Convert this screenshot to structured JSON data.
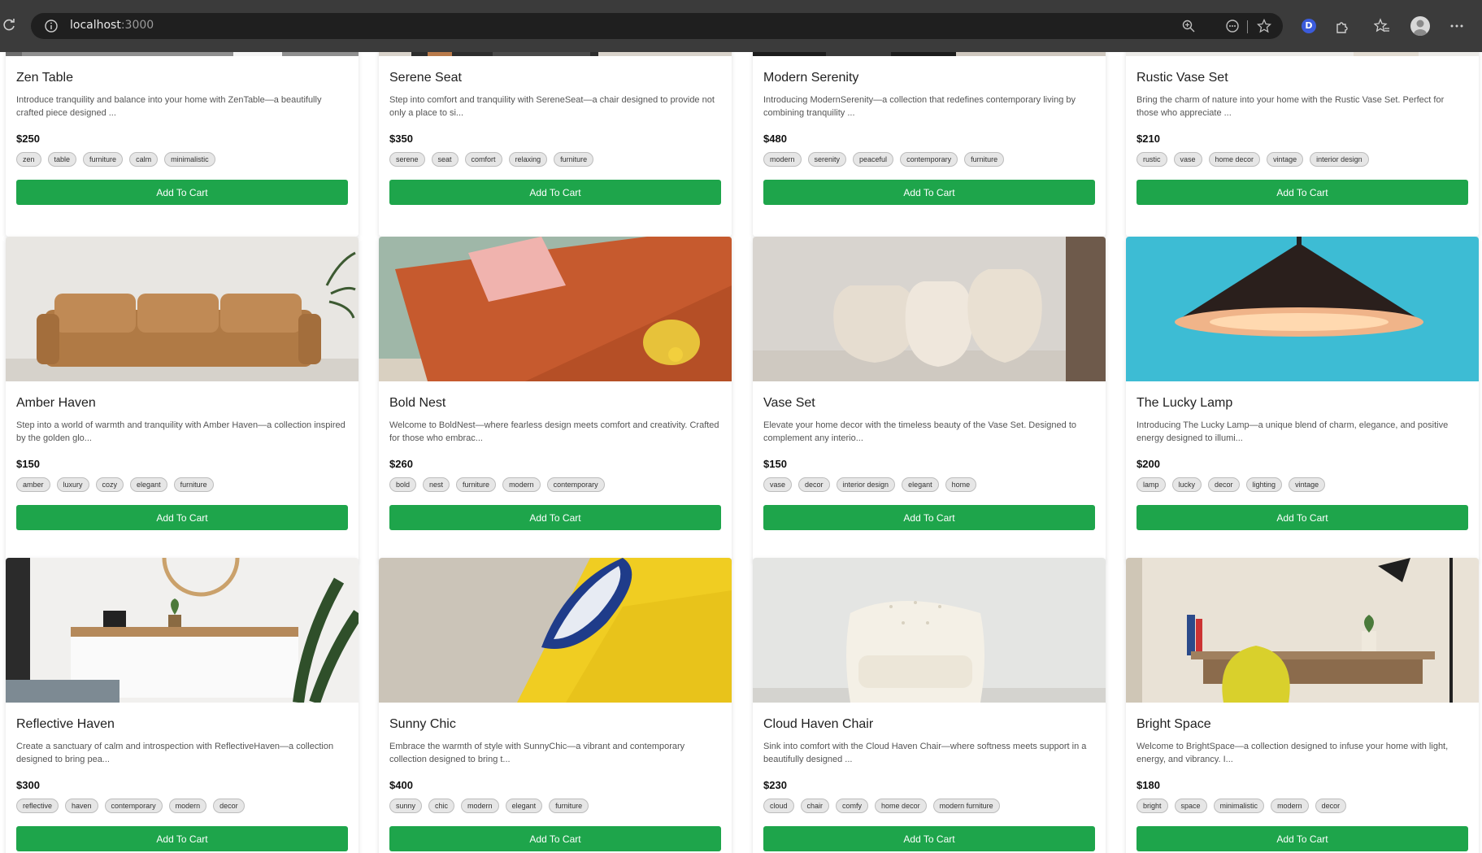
{
  "browser": {
    "url_host": "localhost",
    "url_port": ":3000"
  },
  "products": [
    {
      "title": "Zen Table",
      "description": "Introduce tranquility and balance into your home with ZenTable—a beautifully crafted piece designed ...",
      "price": "$250",
      "tags": [
        "zen",
        "table",
        "furniture",
        "calm",
        "minimalistic"
      ],
      "button": "Add To Cart",
      "image": "zen-table-photo"
    },
    {
      "title": "Serene Seat",
      "description": "Step into comfort and tranquility with SereneSeat—a chair designed to provide not only a place to si...",
      "price": "$350",
      "tags": [
        "serene",
        "seat",
        "comfort",
        "relaxing",
        "furniture"
      ],
      "button": "Add To Cart",
      "image": "serene-seat-photo"
    },
    {
      "title": "Modern Serenity",
      "description": "Introducing ModernSerenity—a collection that redefines contemporary living by combining tranquility ...",
      "price": "$480",
      "tags": [
        "modern",
        "serenity",
        "peaceful",
        "contemporary",
        "furniture"
      ],
      "button": "Add To Cart",
      "image": "modern-serenity-photo"
    },
    {
      "title": "Rustic Vase Set",
      "description": "Bring the charm of nature into your home with the Rustic Vase Set. Perfect for those who appreciate ...",
      "price": "$210",
      "tags": [
        "rustic",
        "vase",
        "home decor",
        "vintage",
        "interior design"
      ],
      "button": "Add To Cart",
      "image": "rustic-vase-photo"
    },
    {
      "title": "Amber Haven",
      "description": "Step into a world of warmth and tranquility with Amber Haven—a collection inspired by the golden glo...",
      "price": "$150",
      "tags": [
        "amber",
        "luxury",
        "cozy",
        "elegant",
        "furniture"
      ],
      "button": "Add To Cart",
      "image": "leather-sofa-photo"
    },
    {
      "title": "Bold Nest",
      "description": "Welcome to BoldNest—where fearless design meets comfort and creativity. Crafted for those who embrac...",
      "price": "$260",
      "tags": [
        "bold",
        "nest",
        "furniture",
        "modern",
        "contemporary"
      ],
      "button": "Add To Cart",
      "image": "orange-sofa-photo"
    },
    {
      "title": "Vase Set",
      "description": "Elevate your home decor with the timeless beauty of the Vase Set. Designed to complement any interio...",
      "price": "$150",
      "tags": [
        "vase",
        "decor",
        "interior design",
        "elegant",
        "home"
      ],
      "button": "Add To Cart",
      "image": "ceramic-vases-photo"
    },
    {
      "title": "The Lucky Lamp",
      "description": "Introducing The Lucky Lamp—a unique blend of charm, elegance, and positive energy designed to illumi...",
      "price": "$200",
      "tags": [
        "lamp",
        "lucky",
        "decor",
        "lighting",
        "vintage"
      ],
      "button": "Add To Cart",
      "image": "pendant-lamp-photo"
    },
    {
      "title": "Reflective Haven",
      "description": "Create a sanctuary of calm and introspection with ReflectiveHaven—a collection designed to bring pea...",
      "price": "$300",
      "tags": [
        "reflective",
        "haven",
        "contemporary",
        "modern",
        "decor"
      ],
      "button": "Add To Cart",
      "image": "sideboard-room-photo"
    },
    {
      "title": "Sunny Chic",
      "description": "Embrace the warmth of style with SunnyChic—a vibrant and contemporary collection designed to bring t...",
      "price": "$400",
      "tags": [
        "sunny",
        "chic",
        "modern",
        "elegant",
        "furniture"
      ],
      "button": "Add To Cart",
      "image": "yellow-sofa-photo"
    },
    {
      "title": "Cloud Haven Chair",
      "description": "Sink into comfort with the Cloud Haven Chair—where softness meets support in a beautifully designed ...",
      "price": "$230",
      "tags": [
        "cloud",
        "chair",
        "comfy",
        "home decor",
        "modern furniture"
      ],
      "button": "Add To Cart",
      "image": "white-armchair-photo"
    },
    {
      "title": "Bright Space",
      "description": "Welcome to BrightSpace—a collection designed to infuse your home with light, energy, and vibrancy. I...",
      "price": "$180",
      "tags": [
        "bright",
        "space",
        "minimalistic",
        "modern",
        "decor"
      ],
      "button": "Add To Cart",
      "image": "desk-workspace-photo"
    }
  ],
  "colors": {
    "accent_button": "#1ea54b",
    "browser_chrome": "#3b3b3b"
  }
}
